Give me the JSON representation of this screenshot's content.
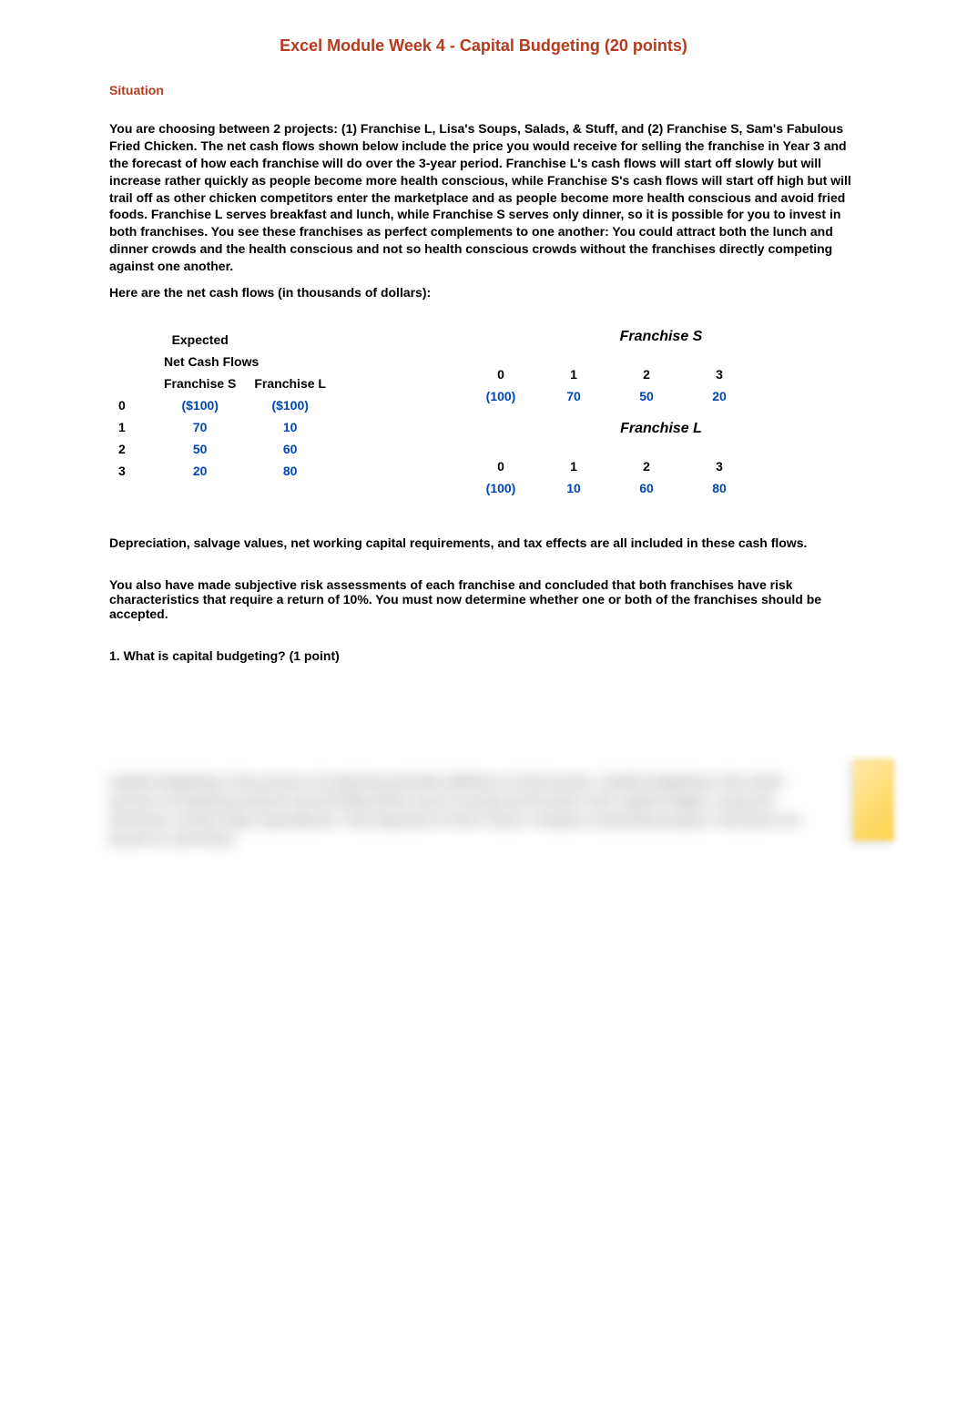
{
  "title": "Excel Module Week 4 - Capital Budgeting (20 points)",
  "situation_label": "Situation",
  "intro": "You are choosing between 2 projects:  (1) Franchise L, Lisa's Soups, Salads, & Stuff, and (2) Franchise S, Sam's Fabulous Fried Chicken.  The net cash flows shown below include the price you would receive for selling the franchise in Year 3 and the forecast of how each franchise will do over the 3-year period.  Franchise L's cash flows will start off slowly but will increase rather quickly as people become more health conscious, while Franchise S's cash flows will start off high but will trail off as other chicken competitors enter the marketplace and as people become more health conscious and avoid fried foods.  Franchise L serves breakfast and lunch, while Franchise S serves only dinner, so it is possible for you to invest in both franchises.  You see these franchises as perfect complements to one another: You could attract both the lunch and dinner crowds and the health conscious and not so health conscious crowds without the franchises directly competing against one another.",
  "intro2": "  Here are the net cash flows (in thousands of dollars):",
  "left": {
    "h1": "Expected",
    "h2": "Net Cash Flows",
    "colS": "Franchise S",
    "colL": "Franchise L",
    "rows": [
      {
        "y": "0",
        "s": "($100)",
        "l": "($100)"
      },
      {
        "y": "1",
        "s": "70",
        "l": "10"
      },
      {
        "y": "2",
        "s": "50",
        "l": "60"
      },
      {
        "y": "3",
        "s": "20",
        "l": "80"
      }
    ]
  },
  "rightS": {
    "title": "Franchise S",
    "cols": [
      "0",
      "1",
      "2",
      "3"
    ],
    "vals": [
      "(100)",
      "70",
      "50",
      "20"
    ]
  },
  "rightL": {
    "title": "Franchise L",
    "cols": [
      "0",
      "1",
      "2",
      "3"
    ],
    "vals": [
      "(100)",
      "10",
      "60",
      "80"
    ]
  },
  "note1": "Depreciation, salvage values, net working capital requirements, and tax effects are all included in these cash flows.",
  "note2": "You also have made subjective risk assessments of each franchise and concluded that both franchises have risk characteristics that require a return of 10%.  You must now determine whether one or both of the franchises should be accepted.",
  "q1": "1.  What is capital budgeting?   (1 point)",
  "blurred": "Capital budgeting is the process of analyzing potential additions to fixed assets. Capital budgeting is the whole process of analyzing projects and deciding which ones to accept and include in the capital budget. Long-term decisions; involve large expenditures. Very important to firm's future. Analysis of potential projects. Decisions are based on cash flows."
}
